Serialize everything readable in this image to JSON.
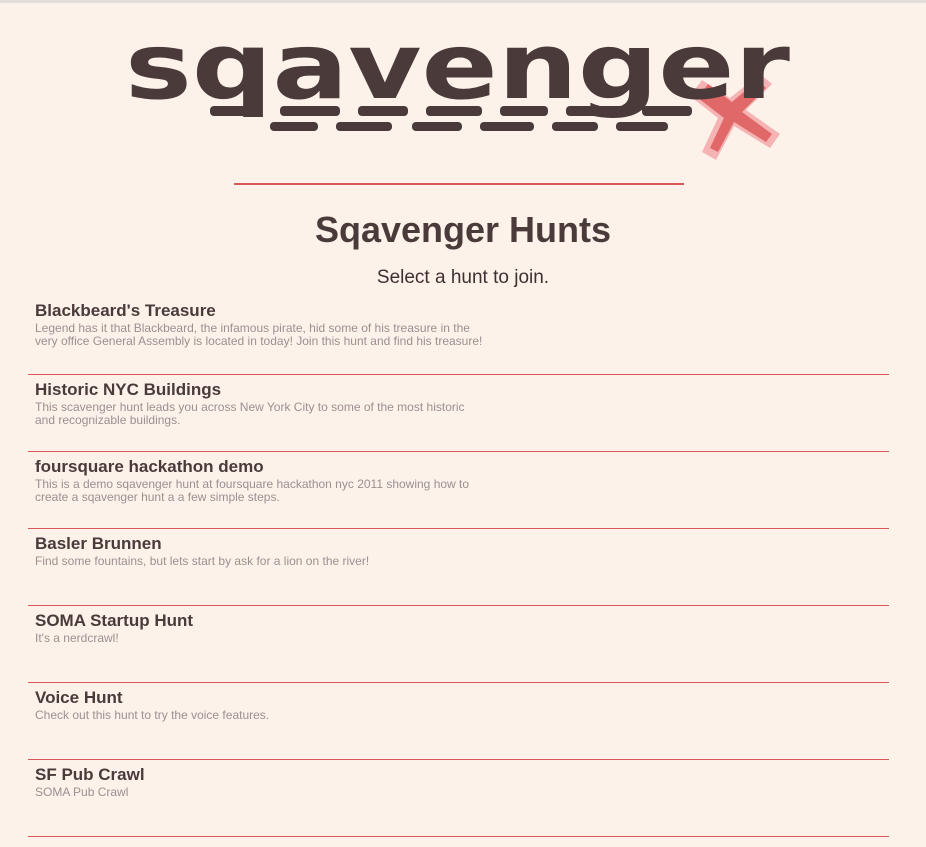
{
  "logo": {
    "text": "sqavenger",
    "brand_color": "#4a3a3a",
    "accent_color": "#e06868"
  },
  "page": {
    "title": "Sqavenger Hunts",
    "subtitle": "Select a hunt to join."
  },
  "hunts": [
    {
      "title": "Blackbeard's Treasure",
      "description": "Legend has it that Blackbeard, the infamous pirate, hid some of his treasure in the very office General Assembly is located in today! Join this hunt and find his treasure!"
    },
    {
      "title": "Historic NYC Buildings",
      "description": "This scavenger hunt leads you across New York City to some of the most historic and recognizable buildings."
    },
    {
      "title": "foursquare hackathon demo",
      "description": "This is a demo sqavenger hunt at foursquare hackathon nyc 2011 showing how to create a sqavenger hunt a a few simple steps."
    },
    {
      "title": "Basler Brunnen",
      "description": "Find some fountains, but lets start by ask for a lion on the river!"
    },
    {
      "title": "SOMA Startup Hunt",
      "description": "It's a nerdcrawl!"
    },
    {
      "title": "Voice Hunt",
      "description": "Check out this hunt to try the voice features."
    },
    {
      "title": "SF Pub Crawl",
      "description": "SOMA Pub Crawl"
    }
  ],
  "colors": {
    "background": "#fcf2ea",
    "divider": "#d9585a",
    "text": "#4a3a3a",
    "muted": "#9b9090"
  }
}
